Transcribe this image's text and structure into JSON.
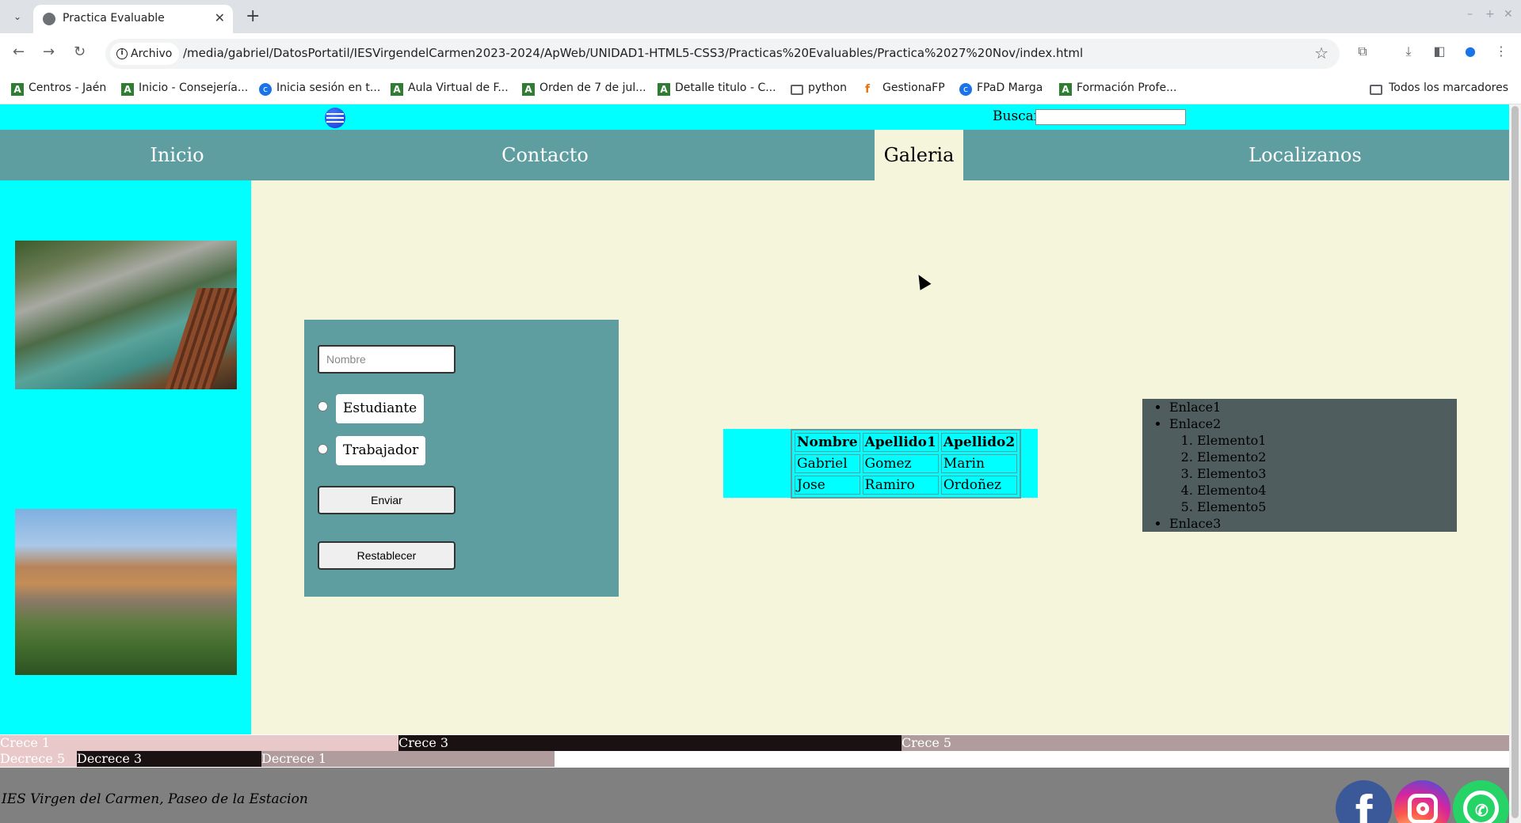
{
  "browser": {
    "tab_title": "Practica Evaluable",
    "chip_label": "Archivo",
    "url": "/media/gabriel/DatosPortatil/IESVirgendelCarmen2023-2024/ApWeb/UNIDAD1-HTML5-CSS3/Practicas%20Evaluables/Practica%2027%20Nov/index.html",
    "bookmarks": [
      {
        "label": "Centros - Jaén",
        "icon": "green"
      },
      {
        "label": "Inicio - Consejería...",
        "icon": "green"
      },
      {
        "label": "Inicia sesión en t...",
        "icon": "blue"
      },
      {
        "label": "Aula Virtual de F...",
        "icon": "green"
      },
      {
        "label": "Orden de 7 de jul...",
        "icon": "green"
      },
      {
        "label": "Detalle titulo - C...",
        "icon": "green"
      },
      {
        "label": "python",
        "icon": "folder"
      },
      {
        "label": "GestionaFP",
        "icon": "orange"
      },
      {
        "label": "FPaD Marga",
        "icon": "blue"
      },
      {
        "label": "Formación Profe...",
        "icon": "green"
      }
    ],
    "all_bookmarks": "Todos los marcadores"
  },
  "page": {
    "search_label": "Buscar",
    "menu": [
      "Inicio",
      "Contacto",
      "Galeria",
      "Localizanos"
    ],
    "active_menu": "Galeria",
    "form": {
      "name_placeholder": "Nombre",
      "radio1": "Estudiante",
      "radio2": "Trabajador",
      "submit": "Enviar",
      "reset": "Restablecer"
    },
    "table": {
      "headers": [
        "Nombre",
        "Apellido1",
        "Apellido2"
      ],
      "rows": [
        [
          "Gabriel",
          "Gomez",
          "Marin"
        ],
        [
          "Jose",
          "Ramiro",
          "Ordoñez"
        ]
      ]
    },
    "links": {
      "enlace1": "Enlace1",
      "enlace2": "Enlace2",
      "elementos": [
        "Elemento1",
        "Elemento2",
        "Elemento3",
        "Elemento4",
        "Elemento5"
      ],
      "enlace3": "Enlace3"
    },
    "grow_bars": {
      "crece1": "Crece 1",
      "crece3": "Crece 3",
      "crece5": "Crece 5"
    },
    "shrink_bars": {
      "decrece5": "Decrece 5",
      "decrece3": "Decrece 3",
      "decrece1": "Decrece 1"
    },
    "footer_text": "IES Virgen del Carmen, Paseo de la Estacion"
  },
  "colors": {
    "cyan": "#00ffff",
    "cadet_blue": "#5f9ea0",
    "beige": "#f5f5dc",
    "dark_slate": "#4f5d5e",
    "footer_gray": "#808080",
    "crece1": "#e8c8c8",
    "crece3": "#1a1212",
    "crece5": "#b09c9c"
  },
  "icons": [
    "globe-logo-icon",
    "facebook-icon",
    "instagram-icon",
    "whatsapp-icon"
  ]
}
